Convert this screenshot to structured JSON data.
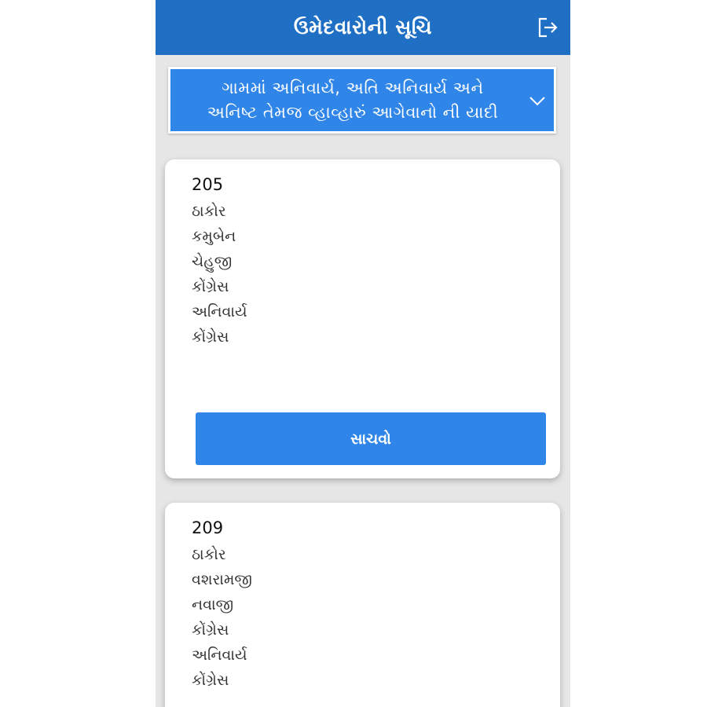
{
  "header": {
    "title": "ઉમેદવારોની સૂચિ",
    "logout_icon": "logout-icon",
    "color": "#1f6fc4"
  },
  "dropdown": {
    "line1": "ગામમાં અનિવાર્ય, અતિ અનિવાર્ય અને",
    "line2": "અનિષ્ટ તેમજ વ્હાવ્હારું આગેવાનો ની યાદી",
    "icon": "chevron-down-icon",
    "color": "#2f86e8"
  },
  "candidates": [
    {
      "number": "205",
      "lines": [
        "ઠાકોર",
        "કમુબેન",
        "ચેહુજી",
        "કોંગ્રેસ",
        "અનિવાર્ય",
        "કોંગ્રેસ"
      ],
      "save_label": "સાચવો"
    },
    {
      "number": "209",
      "lines": [
        "ઠાકોર",
        "વશરામજી",
        "નવાજી",
        "કોંગ્રેસ",
        "અનિવાર્ય",
        "કોંગ્રેસ"
      ]
    }
  ],
  "colors": {
    "background": "#e6e6e6",
    "card": "#ffffff",
    "button": "#2f86e8"
  }
}
